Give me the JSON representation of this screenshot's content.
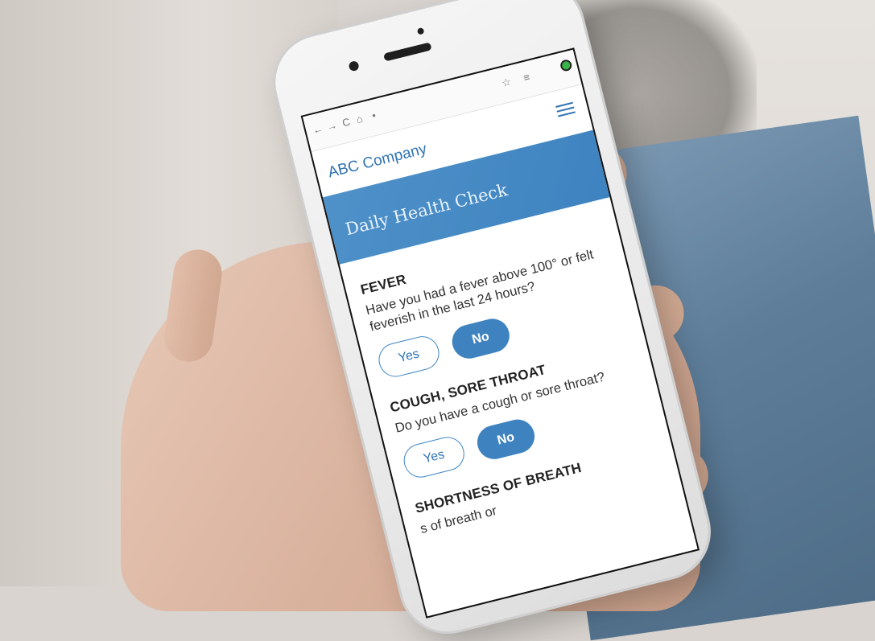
{
  "browser": {
    "nav_back": "←",
    "nav_forward": "→",
    "reload": "C",
    "home": "⌂",
    "lock": "•",
    "star": "☆",
    "menu_icon": "≡"
  },
  "site": {
    "brand": "ABC Company",
    "banner_title": "Daily Health Check"
  },
  "questions": [
    {
      "title": "FEVER",
      "text": "Have you had a fever above 100° or felt feverish in the last 24 hours?",
      "yes": "Yes",
      "no": "No",
      "selected": "No"
    },
    {
      "title": "COUGH, SORE THROAT",
      "text": "Do you have a cough or sore throat?",
      "yes": "Yes",
      "no": "No",
      "selected": "No"
    },
    {
      "title": "SHORTNESS OF BREATH",
      "text": "s of breath or"
    }
  ],
  "colors": {
    "accent": "#3e83c0",
    "brand_text": "#2f73b5",
    "banner": "#4f91c9"
  }
}
